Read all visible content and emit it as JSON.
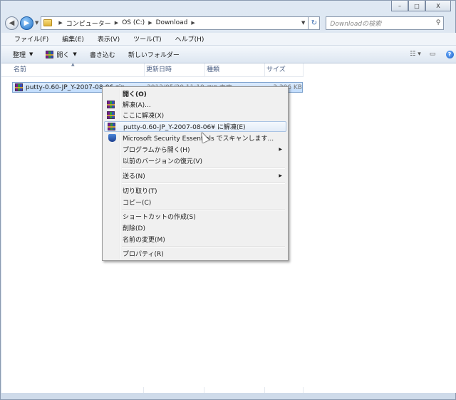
{
  "window": {
    "minimize": "–",
    "maximize": "□",
    "close": "X"
  },
  "address": {
    "crumbs": [
      "コンピューター",
      "OS (C:)",
      "Download"
    ],
    "search_placeholder": "Downloadの検索"
  },
  "menubar": [
    "ファイル(F)",
    "編集(E)",
    "表示(V)",
    "ツール(T)",
    "ヘルプ(H)"
  ],
  "toolbar": {
    "organize": "整理",
    "open": "開く",
    "burn": "書き込む",
    "new_folder": "新しいフォルダー"
  },
  "columns": [
    "名前",
    "更新日時",
    "種類",
    "サイズ"
  ],
  "file": {
    "name": "putty-0.60-JP_Y-2007-08-06.zip",
    "date": "2012/05/20 11:10",
    "type": "ZIP 書庫",
    "size": "3,306 KB"
  },
  "context_menu": {
    "open": "開く(O)",
    "extract": "解凍(A)...",
    "extract_here": "ここに解凍(X)",
    "extract_to": "putty-0.60-JP_Y-2007-08-06¥ に解凍(E)",
    "scan": "Microsoft Security Essentials でスキャンします...",
    "open_with": "プログラムから開く(H)",
    "restore": "以前のバージョンの復元(V)",
    "send_to": "送る(N)",
    "cut": "切り取り(T)",
    "copy": "コピー(C)",
    "shortcut": "ショートカットの作成(S)",
    "delete": "削除(D)",
    "rename": "名前の変更(M)",
    "properties": "プロパティ(R)"
  }
}
